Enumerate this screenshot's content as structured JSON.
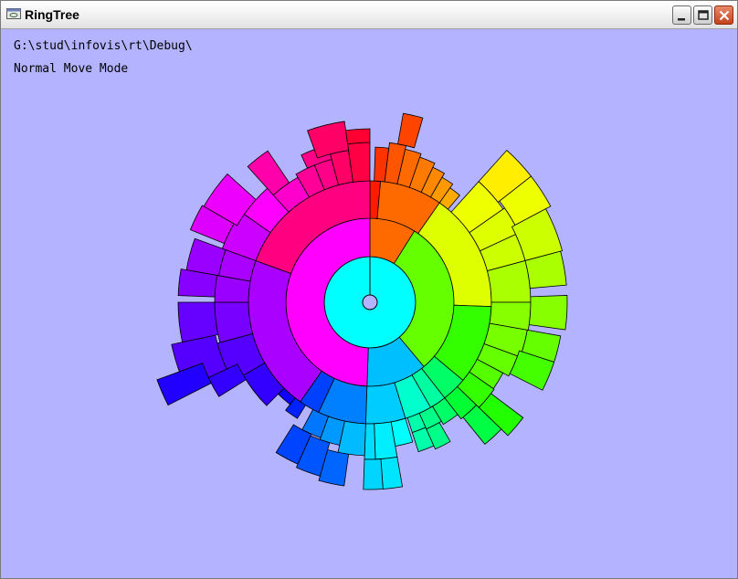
{
  "window": {
    "title": "RingTree",
    "icon": "app-window-icon",
    "controls": [
      "minimize",
      "maximize",
      "close"
    ]
  },
  "status": {
    "path": "G:\\stud\\infovis\\rt\\Debug\\",
    "mode": "Normal Move Mode"
  },
  "colors": {
    "background": "#b3b3ff",
    "root_ring": "#00ffff",
    "center_hub": "#b3b3ff",
    "stroke": "#000000"
  },
  "visualization": {
    "type": "radial-tree-sunburst",
    "name": "ringtree"
  }
}
